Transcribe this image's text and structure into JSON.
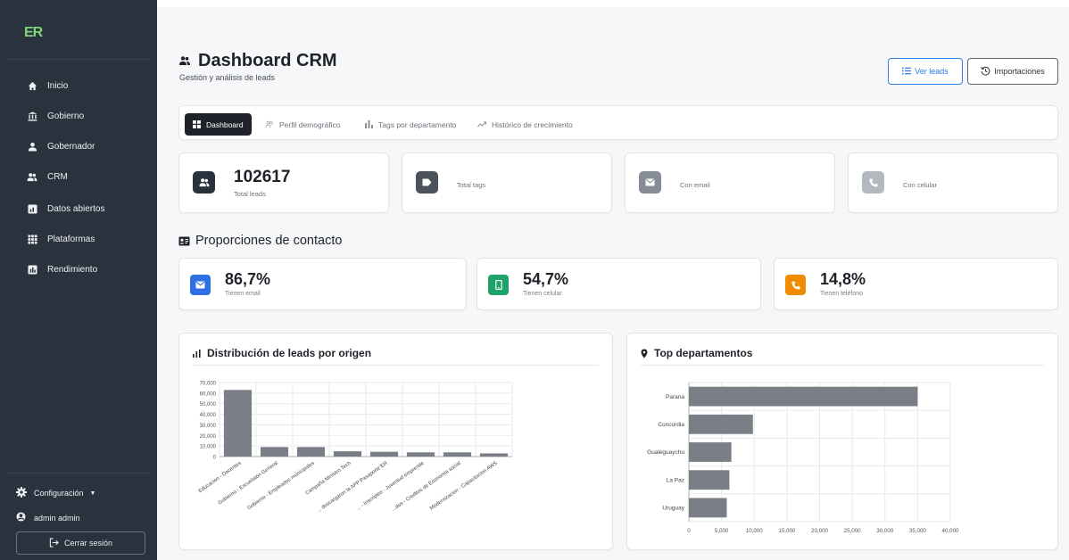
{
  "app": {
    "logo": "ER"
  },
  "sidebar": {
    "items": [
      {
        "label": "Inicio",
        "icon": "home-icon"
      },
      {
        "label": "Gobierno",
        "icon": "bank-icon"
      },
      {
        "label": "Gobernador",
        "icon": "person-icon"
      },
      {
        "label": "CRM",
        "icon": "users-icon"
      },
      {
        "label": "Datos abiertos",
        "icon": "data-icon"
      },
      {
        "label": "Plataformas",
        "icon": "grid-icon"
      },
      {
        "label": "Rendimiento",
        "icon": "chart-icon"
      }
    ],
    "config_label": "Configuración",
    "user_label": "admin admin",
    "logout_label": "Cerrar sesión"
  },
  "header": {
    "title": "Dashboard CRM",
    "subtitle": "Gestión y análisis de leads",
    "btn_leads": "Ver leads",
    "btn_imports": "Importaciones"
  },
  "tabs": [
    {
      "label": "Dashboard",
      "active": true
    },
    {
      "label": "Perfil demográfico",
      "active": false
    },
    {
      "label": "Tags por departamento",
      "active": false
    },
    {
      "label": "Histórico de crecimiento",
      "active": false
    }
  ],
  "stats": [
    {
      "value": "102617",
      "label": "Total leads",
      "color": "#2a323d"
    },
    {
      "value": "",
      "label": "Total tags",
      "color": "#4b525b"
    },
    {
      "value": "",
      "label": "Con email",
      "color": "#868c95"
    },
    {
      "value": "",
      "label": "Con celular",
      "color": "#b4b9c0"
    }
  ],
  "proportions": {
    "title": "Proporciones de contacto",
    "items": [
      {
        "pct": "86,7%",
        "label": "Tienen email",
        "color": "#2f6fe4"
      },
      {
        "pct": "54,7%",
        "label": "Tienen celular",
        "color": "#1fa36a"
      },
      {
        "pct": "14,8%",
        "label": "Tienen teléfono",
        "color": "#f08c00"
      }
    ]
  },
  "charts": {
    "origin_title": "Distribución de leads por origen",
    "dept_title": "Top departamentos"
  },
  "chart_data": [
    {
      "type": "bar",
      "title": "Distribución de leads por origen",
      "categories": [
        "Educacion - Docentes",
        "Gobierno - Escuelatón General",
        "Gobierno - Empleados municipales",
        "Campaña Ministro Tech",
        "... descargaron la APP Pasaporte ER",
        "... - Inscriptos - Juventud emprende",
        "...dos - Creditos de Economia social",
        "Modernizacion - Capacitacion AWS"
      ],
      "values": [
        63000,
        9000,
        9000,
        5000,
        4500,
        4000,
        4000,
        3000
      ],
      "ylim": [
        0,
        70000
      ],
      "yticks": [
        "70,000",
        "60,000",
        "50,000",
        "40,000",
        "30,000",
        "20,000",
        "10,000",
        "0"
      ],
      "color": "#7a7e87"
    },
    {
      "type": "bar",
      "orientation": "horizontal",
      "title": "Top departamentos",
      "categories": [
        "Parana",
        "Concordia",
        "Gualeguaychu",
        "La Paz",
        "Uruguay"
      ],
      "values": [
        35000,
        9800,
        6500,
        6200,
        5800
      ],
      "xlim": [
        0,
        40000
      ],
      "xticks": [
        "0",
        "5,000",
        "10,000",
        "15,000",
        "20,000",
        "25,000",
        "30,000",
        "35,000",
        "40,000"
      ],
      "color": "#7a7e87"
    }
  ]
}
